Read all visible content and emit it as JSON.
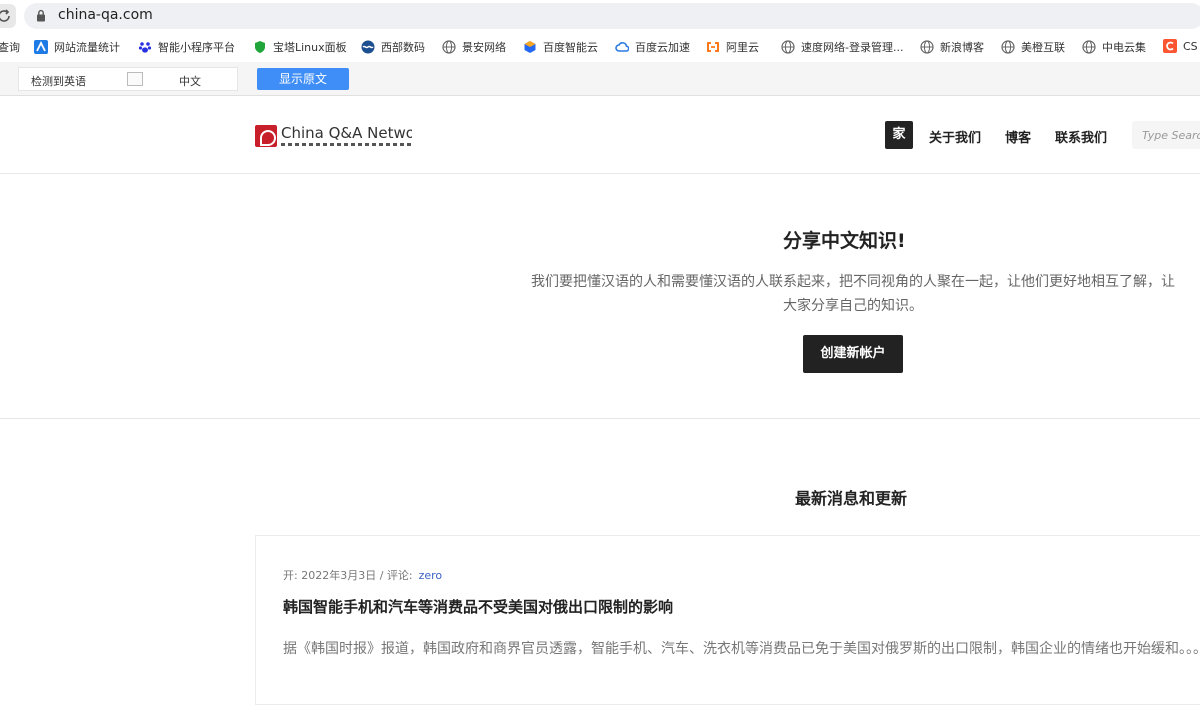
{
  "browser": {
    "url": "china-qa.com"
  },
  "bookmarks": [
    {
      "label": "查询",
      "icon": "none"
    },
    {
      "label": "网站流量统计",
      "icon": "chart-icon"
    },
    {
      "label": "智能小程序平台",
      "icon": "paw-icon"
    },
    {
      "label": "宝塔Linux面板",
      "icon": "shield-icon"
    },
    {
      "label": "西部数码",
      "icon": "wave-icon"
    },
    {
      "label": "景安网络",
      "icon": "globe-icon"
    },
    {
      "label": "百度智能云",
      "icon": "cube-icon"
    },
    {
      "label": "百度云加速",
      "icon": "cloud-icon"
    },
    {
      "label": "阿里云",
      "icon": "aliyun-icon"
    },
    {
      "label": "速度网络-登录管理...",
      "icon": "globe-icon"
    },
    {
      "label": "新浪博客",
      "icon": "globe-icon"
    },
    {
      "label": "美橙互联",
      "icon": "globe-icon"
    },
    {
      "label": "中电云集",
      "icon": "globe-icon"
    },
    {
      "label": "CS",
      "icon": "csdn-icon"
    }
  ],
  "translate": {
    "detected": "检测到英语",
    "target": "中文",
    "show_original": "显示原文"
  },
  "site": {
    "logo_text": "China Q&A Netwo",
    "nav": {
      "home": "家",
      "about": "关于我们",
      "blog": "博客",
      "contact": "联系我们"
    },
    "search_placeholder": "Type Search"
  },
  "hero": {
    "title": "分享中文知识!",
    "description": "我们要把懂汉语的人和需要懂汉语的人联系起来，把不同视角的人聚在一起，让他们更好地相互了解，让大家分享自己的知识。",
    "cta": "创建新帐户"
  },
  "news": {
    "section_title": "最新消息和更新",
    "posts": [
      {
        "meta": "开: 2022年3月3日 / 评论:",
        "author": "zero",
        "title": "韩国智能手机和汽车等消费品不受美国对俄出口限制的影响",
        "excerpt": "据《韩国时报》报道，韩国政府和商界官员透露，智能手机、汽车、洗衣机等消费品已免于美国对俄罗斯的出口限制，韩国企业的情绪也开始缓和。。。"
      }
    ]
  },
  "colors": {
    "accent_blue": "#3f8ef7",
    "dark": "#222222",
    "brand_red": "#c8202a",
    "link": "#3b63c4"
  }
}
